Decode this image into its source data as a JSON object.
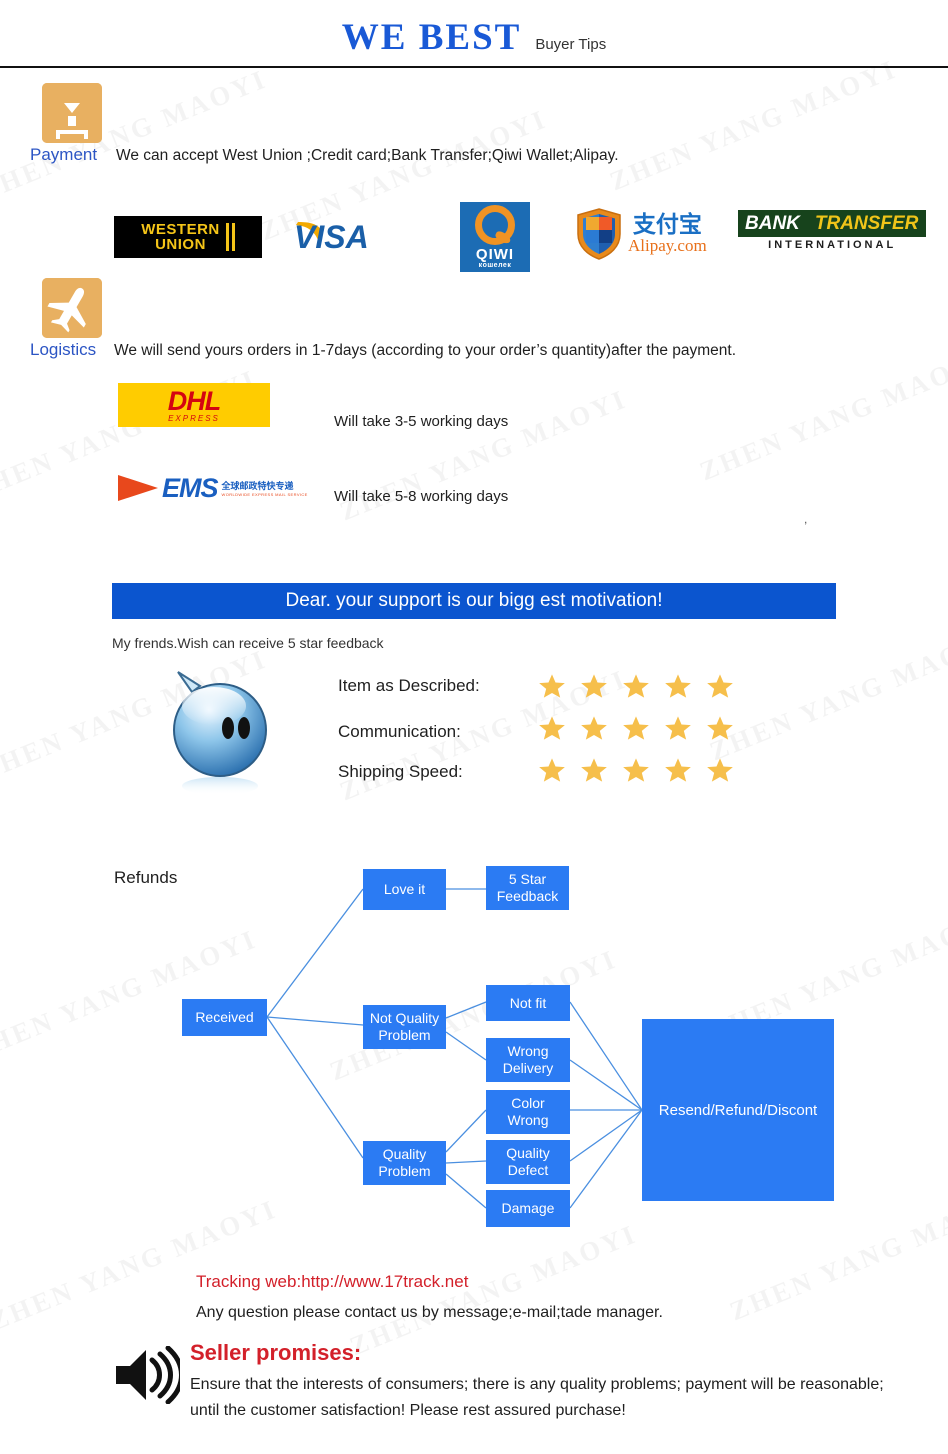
{
  "header": {
    "brand": "WE  BEST",
    "subtitle": "Buyer Tips",
    "brand_color": "#1959d6"
  },
  "payment": {
    "icon": "package-box-icon",
    "label": "Payment",
    "text": "We can accept West Union ;Credit card;Bank Transfer;Qiwi Wallet;Alipay.",
    "logos": [
      {
        "name": "western-union-logo",
        "line1": "WESTERN",
        "line2": "UNION"
      },
      {
        "name": "visa-logo",
        "text": "VISA"
      },
      {
        "name": "qiwi-logo",
        "text": "QIWI",
        "sub": "кошелек"
      },
      {
        "name": "alipay-logo",
        "cn": "支付宝",
        "text": "Alipay.com"
      },
      {
        "name": "bank-transfer-logo",
        "word1": "BANK",
        "word2": "TRANSFER",
        "sub": "INTERNATIONAL"
      }
    ]
  },
  "logistics": {
    "icon": "airplane-icon",
    "label": "Logistics",
    "text": "We will send yours orders in 1-7days (according to your order’s quantity)after the  payment.",
    "carriers": [
      {
        "name": "dhl-logo",
        "main": "DHL",
        "sub": "EXPRESS",
        "note": "Will take 3-5 working days"
      },
      {
        "name": "ems-logo",
        "main": "EMS",
        "cn": "全球邮政特快专递",
        "en": "WORLDWIDE EXPRESS MAIL SERVICE",
        "note": "Will take 5-8 working days"
      }
    ]
  },
  "banner": {
    "text": "Dear. your support is our bigg est motivation!",
    "bg": "#0b55cf",
    "subnote": "My frends.Wish can receive 5 star feedback"
  },
  "ratings": {
    "avatar": "blue-smiley-avatar",
    "star_color": "#f6bf4b",
    "rows": [
      {
        "label": "Item as Described:",
        "stars": 5
      },
      {
        "label": "Communication:",
        "stars": 5
      },
      {
        "label": "Shipping Speed:",
        "stars": 5
      }
    ]
  },
  "flowchart": {
    "title": "Refunds",
    "node_color": "#2b7bf3",
    "edge_color": "#4a8fe0",
    "nodes": [
      {
        "id": "received",
        "label": "Received"
      },
      {
        "id": "love-it",
        "label": "Love it"
      },
      {
        "id": "five-star-feedback",
        "label": "5 Star\nFeedback",
        "l1": "5 Star",
        "l2": "Feedback"
      },
      {
        "id": "not-quality-problem",
        "label": "Not Quality\nProblem",
        "l1": "Not Quality",
        "l2": "Problem"
      },
      {
        "id": "quality-problem",
        "label": "Quality\nProblem",
        "l1": "Quality",
        "l2": "Problem"
      },
      {
        "id": "not-fit",
        "label": "Not fit"
      },
      {
        "id": "wrong-delivery",
        "label": "Wrong\nDelivery",
        "l1": "Wrong",
        "l2": "Delivery"
      },
      {
        "id": "color-wrong",
        "label": "Color\nWrong",
        "l1": "Color",
        "l2": "Wrong"
      },
      {
        "id": "quality-defect",
        "label": "Quality\nDefect",
        "l1": "Quality",
        "l2": "Defect"
      },
      {
        "id": "damage",
        "label": "Damage"
      },
      {
        "id": "resend-refund-discount",
        "label": "Resend/Refund/Discont"
      }
    ]
  },
  "footer": {
    "tracking": "Tracking web:http://www.17track.net",
    "tracking_color": "#d3202a",
    "contact": "Any question please contact us by message;e-mail;tade manager.",
    "promise_icon": "speaker-icon",
    "promise_title": "Seller promises:",
    "promise_body": "Ensure that the interests of consumers; there is any quality problems; payment will be reasonable; until the customer satisfaction! Please rest assured purchase!",
    "artifact": ","
  },
  "watermark": {
    "text": "ZHEN YANG MAOYI"
  }
}
